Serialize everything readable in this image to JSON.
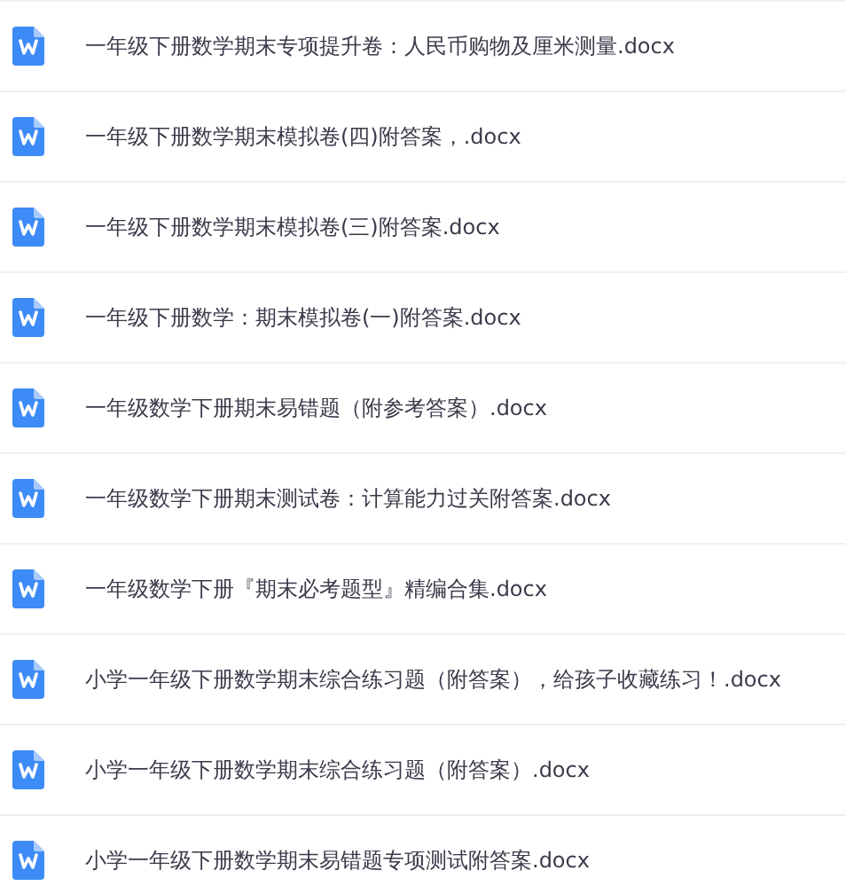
{
  "files": [
    {
      "name": "一年级下册数学期末专项提升卷：人民币购物及厘米测量.docx"
    },
    {
      "name": "一年级下册数学期末模拟卷(四)附答案，.docx"
    },
    {
      "name": "一年级下册数学期末模拟卷(三)附答案.docx"
    },
    {
      "name": "一年级下册数学：期末模拟卷(一)附答案.docx"
    },
    {
      "name": "一年级数学下册期末易错题（附参考答案）.docx"
    },
    {
      "name": "一年级数学下册期末测试卷：计算能力过关附答案.docx"
    },
    {
      "name": "一年级数学下册『期末必考题型』精编合集.docx"
    },
    {
      "name": "小学一年级下册数学期末综合练习题（附答案），给孩子收藏练习！.docx"
    },
    {
      "name": "小学一年级下册数学期末综合练习题（附答案）.docx"
    },
    {
      "name": "小学一年级下册数学期末易错题专项测试附答案.docx"
    }
  ]
}
